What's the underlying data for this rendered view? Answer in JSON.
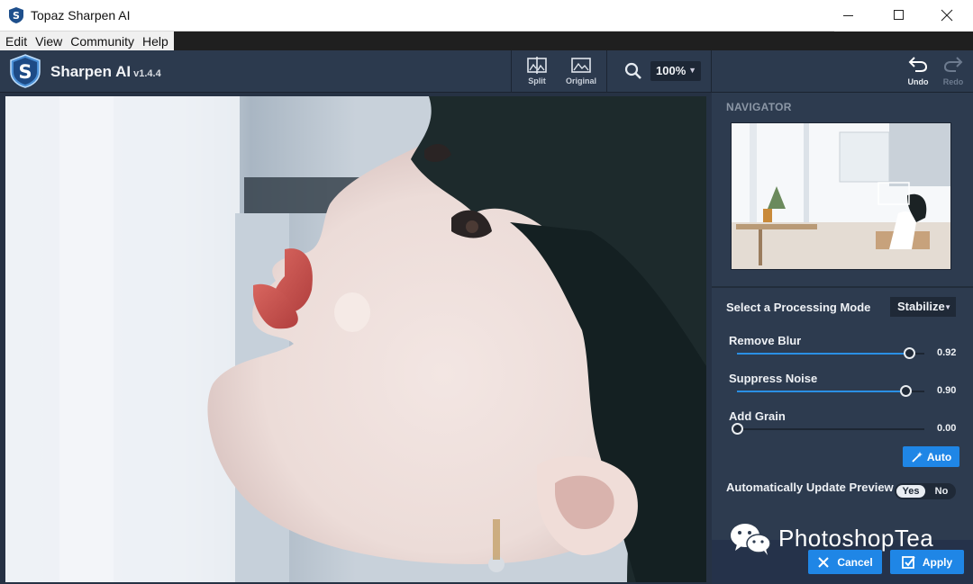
{
  "window": {
    "title": "Topaz Sharpen AI",
    "minimize_glyph": "—",
    "maximize_glyph": "☐",
    "close_glyph": "✕"
  },
  "menu": [
    "Edit",
    "View",
    "Community",
    "Help"
  ],
  "header": {
    "app_name": "Sharpen AI",
    "version": "v1.4.4",
    "split_label": "Split",
    "original_label": "Original",
    "zoom_value": "100%",
    "undo_label": "Undo",
    "redo_label": "Redo"
  },
  "navigator": {
    "title": "NAVIGATOR"
  },
  "processing": {
    "mode_label": "Select a Processing Mode",
    "mode_value": "Stabilize"
  },
  "sliders": [
    {
      "label": "Remove Blur",
      "value": 0.92,
      "display": "0.92"
    },
    {
      "label": "Suppress Noise",
      "value": 0.9,
      "display": "0.90"
    },
    {
      "label": "Add Grain",
      "value": 0.0,
      "display": "0.00"
    }
  ],
  "auto_button": "Auto",
  "auto_update": {
    "label": "Automatically Update Preview",
    "yes": "Yes",
    "no": "No",
    "selected": "Yes"
  },
  "footer": {
    "cancel": "Cancel",
    "apply": "Apply"
  },
  "watermark": "PhotoshopTea",
  "colors": {
    "accent": "#1f86e6",
    "panel": "#2d3b4f",
    "header": "#2c3a4e"
  }
}
